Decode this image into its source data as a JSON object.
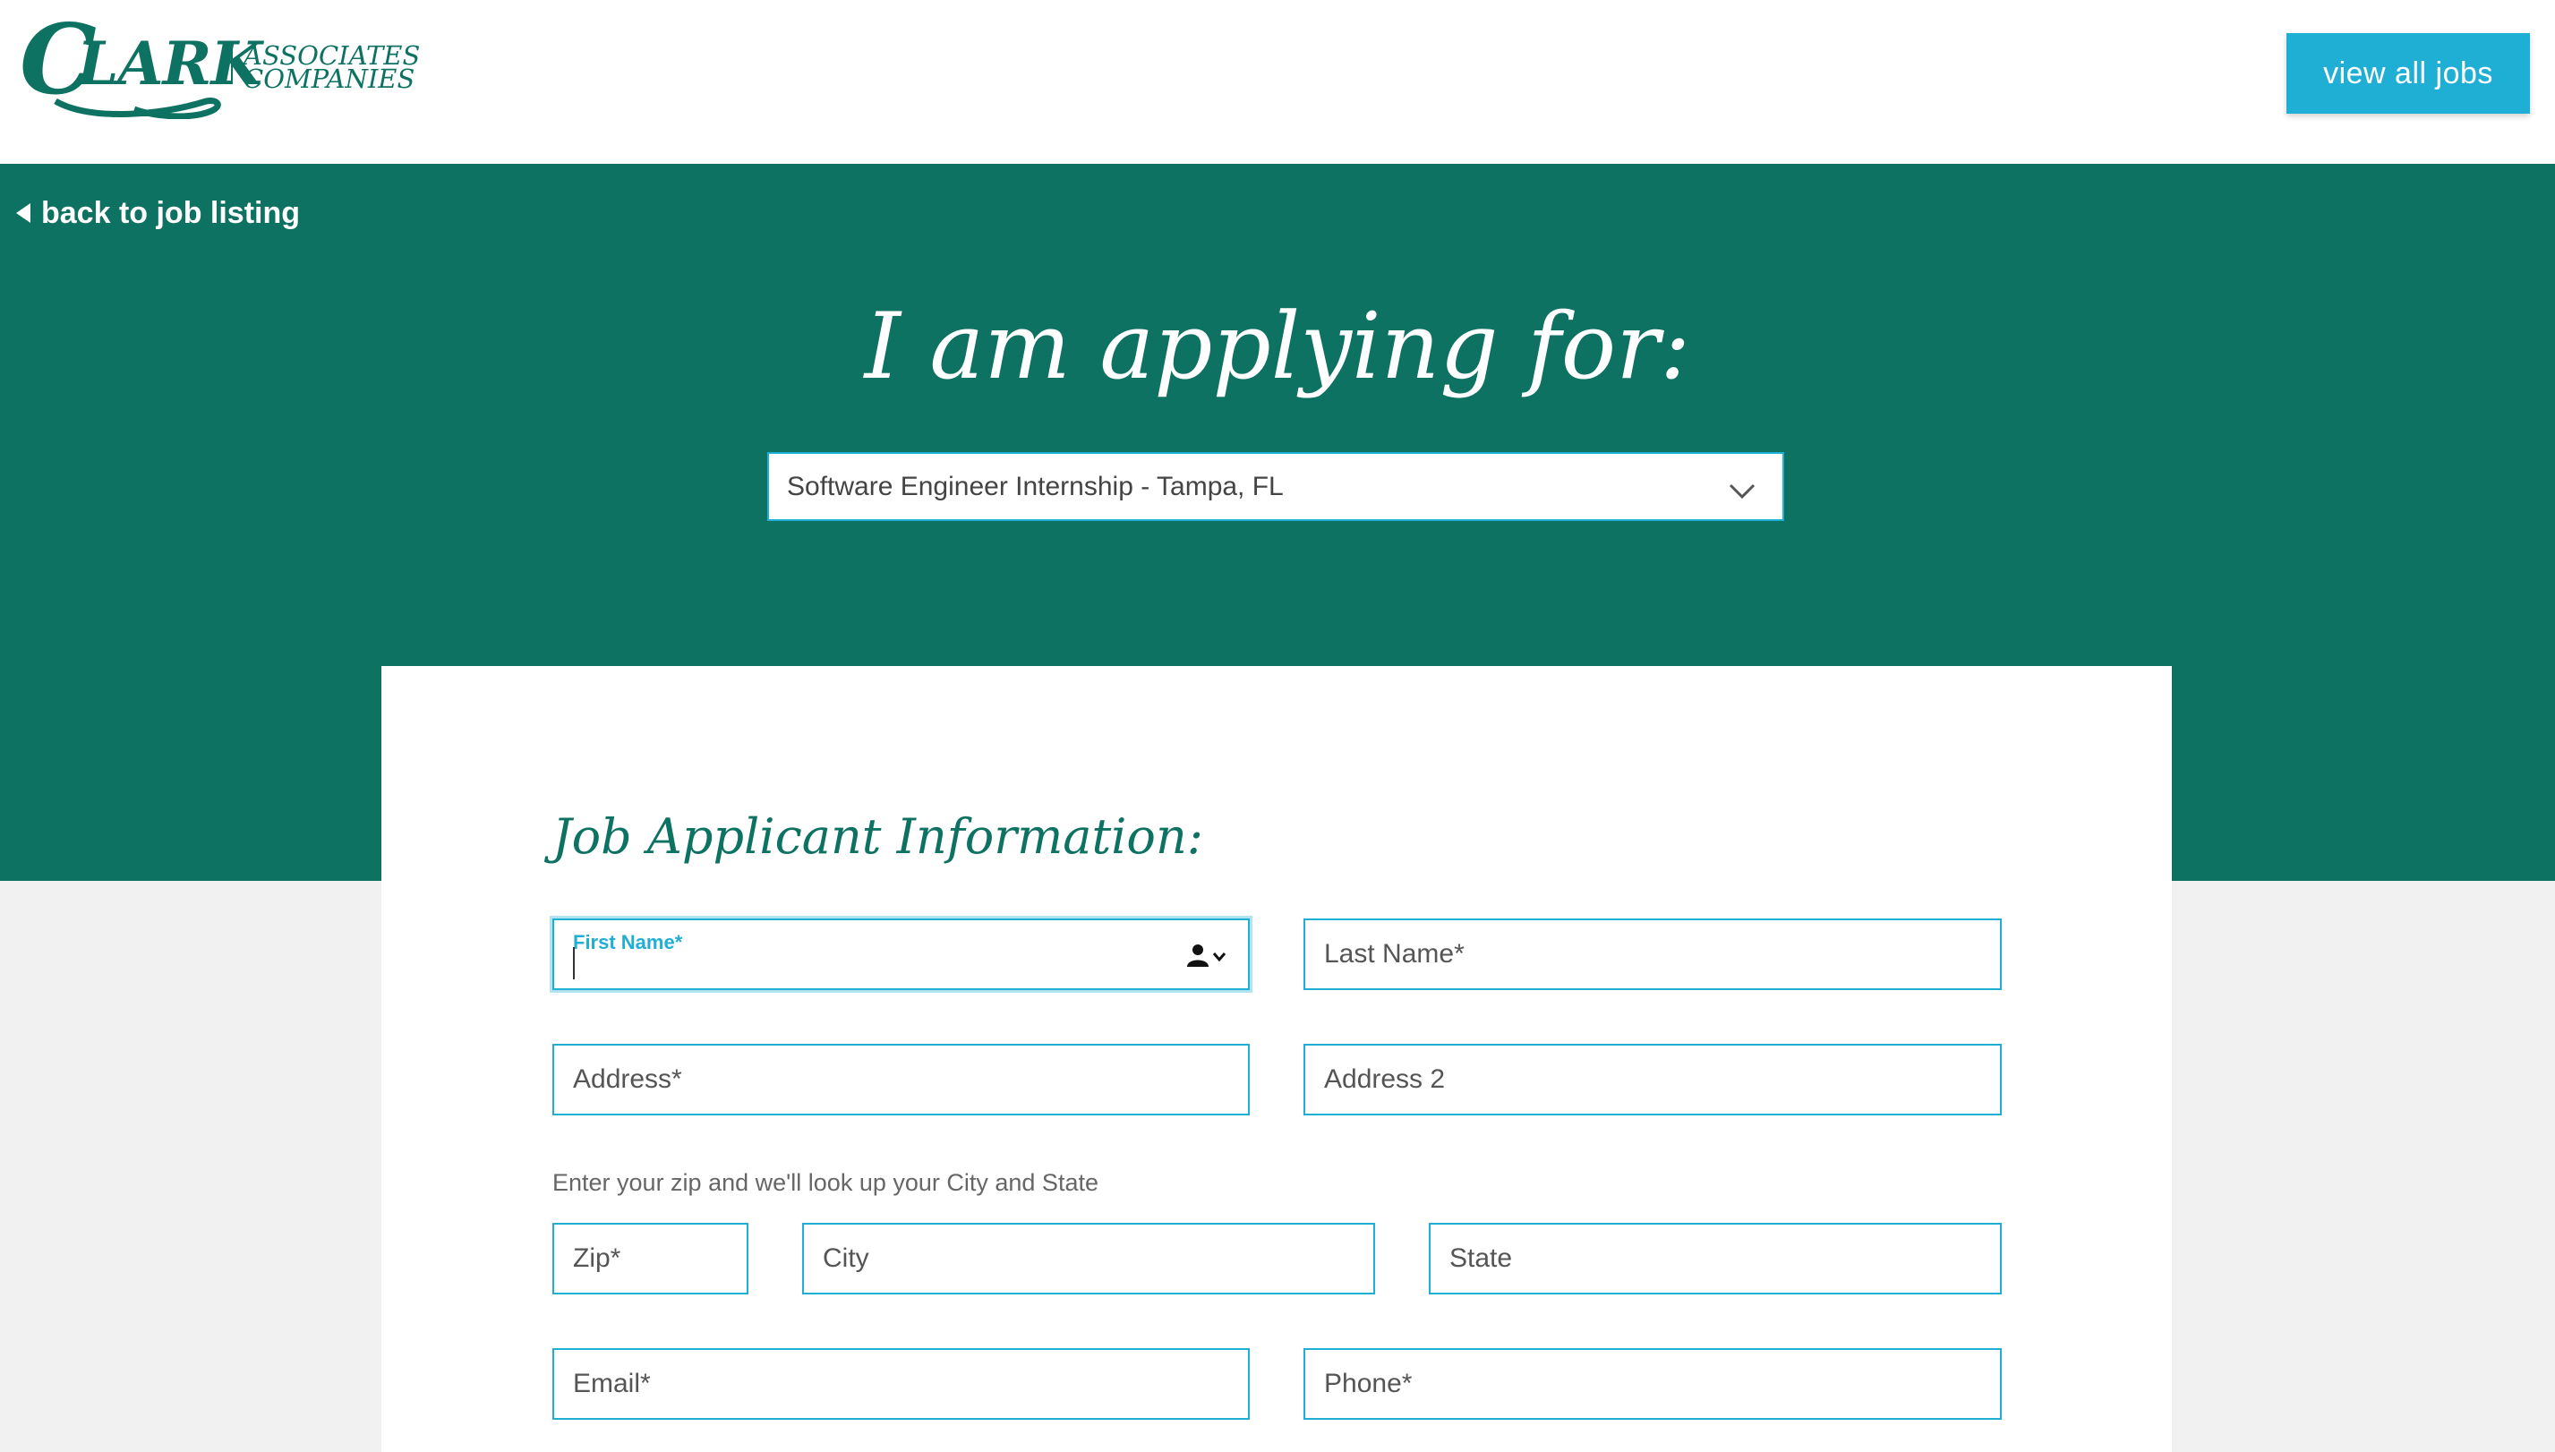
{
  "header": {
    "logo": {
      "name": "CLARK",
      "line1": "ASSOCIATES",
      "line2": "COMPANIES",
      "color": "#0e7262"
    },
    "view_all_jobs_label": "view all jobs"
  },
  "hero": {
    "back_link_label": "back to job listing",
    "title": "I am applying for:",
    "job_select": {
      "selected": "Software Engineer Internship - Tampa, FL"
    }
  },
  "form": {
    "section_title": "Job Applicant Information:",
    "first_name_label": "First Name*",
    "last_name_placeholder": "Last Name*",
    "address_placeholder": "Address*",
    "address2_placeholder": "Address 2",
    "zip_hint": "Enter your zip and we'll look up your City and State",
    "zip_placeholder": "Zip*",
    "city_placeholder": "City",
    "state_placeholder": "State",
    "email_placeholder": "Email*",
    "phone_placeholder": "Phone*"
  },
  "colors": {
    "brand_green": "#0e7262",
    "accent_blue": "#20afd4",
    "page_background": "#f1f1f1"
  },
  "icons": {
    "back": "triangle-left-icon",
    "select": "chevron-down-icon",
    "autofill": "person-autofill-icon"
  }
}
